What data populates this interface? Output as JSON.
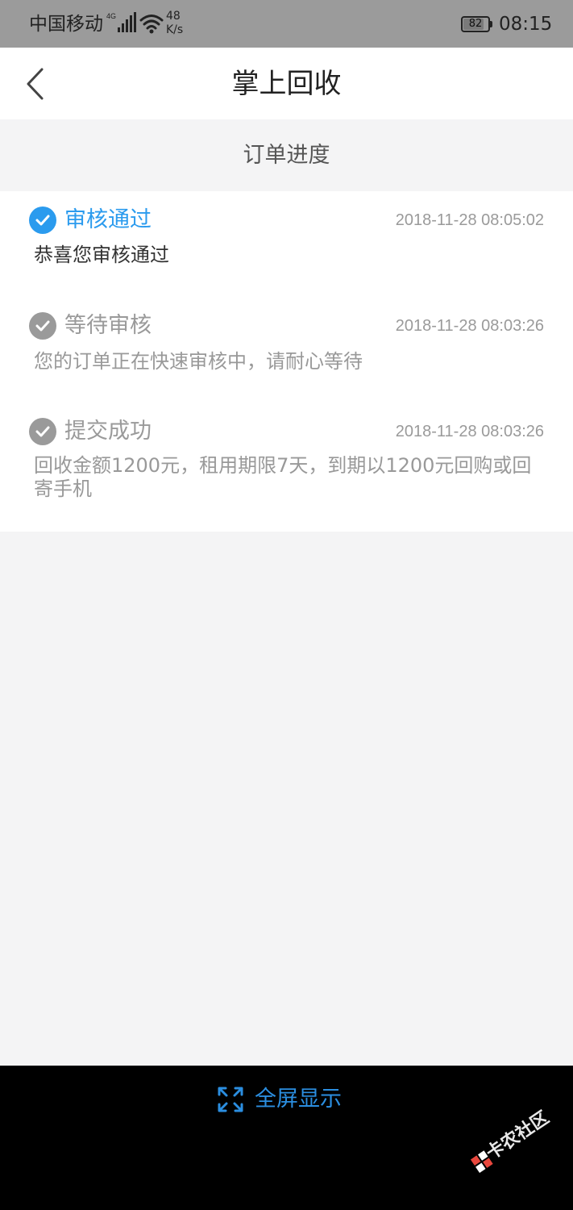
{
  "status_bar": {
    "carrier": "中国移动",
    "network_type": "4G",
    "net_speed_value": "48",
    "net_speed_unit": "K/s",
    "battery_level": "82",
    "battery_fraction": 0.82,
    "time": "08:15"
  },
  "header": {
    "title": "掌上回收",
    "back_icon": "chevron-left-icon"
  },
  "section": {
    "label": "订单进度"
  },
  "colors": {
    "accent": "#2b9bee",
    "inactive": "#9a9a9a",
    "fullscreen": "#2b8ee0",
    "watermark": "#e8473d"
  },
  "steps": [
    {
      "status": "active",
      "title": "审核通过",
      "time": "2018-11-28 08:05:02",
      "description": "恭喜您审核通过"
    },
    {
      "status": "done",
      "title": "等待审核",
      "time": "2018-11-28 08:03:26",
      "description": "您的订单正在快速审核中，请耐心等待"
    },
    {
      "status": "done",
      "title": "提交成功",
      "time": "2018-11-28 08:03:26",
      "description": "回收金额1200元，租用期限7天，到期以1200元回购或回寄手机"
    }
  ],
  "bottom_bar": {
    "fullscreen_label": "全屏显示",
    "fullscreen_icon": "expand-icon"
  },
  "watermark": {
    "text": "卡农社区"
  }
}
